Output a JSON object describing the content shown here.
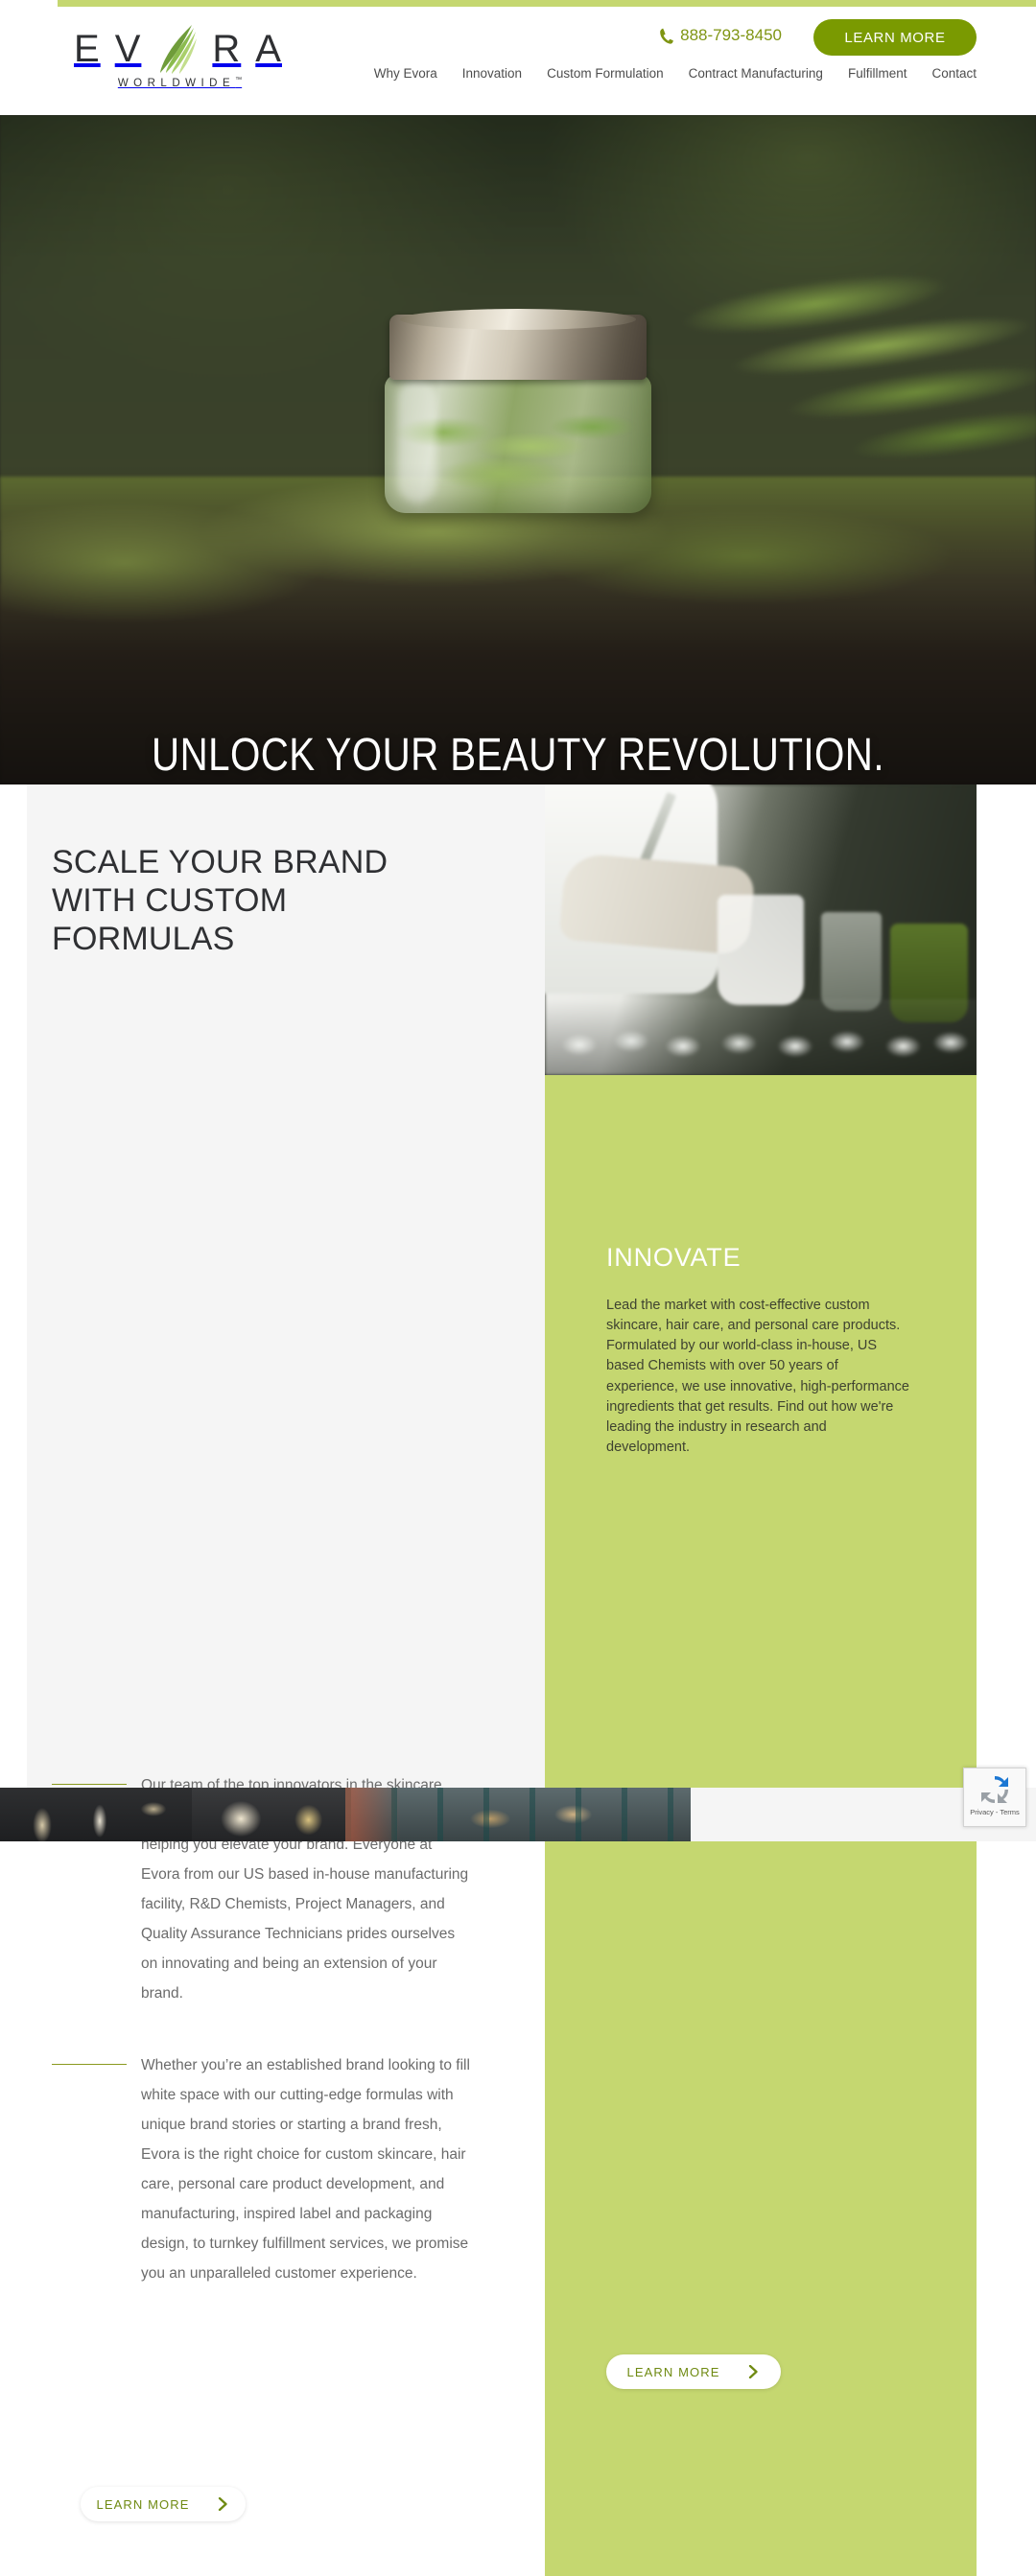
{
  "brand": {
    "name_letters": [
      "E",
      "V",
      "R",
      "A"
    ],
    "leaf_icon": "leaf-icon",
    "tagline": "WORLDWIDE",
    "trademark": "™",
    "accent_green": "#7a9a01",
    "panel_green": "#c5d770",
    "text_dark": "#2f3033"
  },
  "header": {
    "phone": "888-793-8450",
    "phone_icon": "phone-icon",
    "cta_label": "LEARN MORE",
    "nav": [
      {
        "label": "Why Evora"
      },
      {
        "label": "Innovation"
      },
      {
        "label": "Custom Formulation"
      },
      {
        "label": "Contract Manufacturing"
      },
      {
        "label": "Fulfillment"
      },
      {
        "label": "Contact"
      }
    ]
  },
  "hero": {
    "headline": "UNLOCK YOUR BEAUTY REVOLUTION.",
    "image_alt": "cosmetic-jar-on-moss"
  },
  "main": {
    "section_title": "SCALE YOUR BRAND WITH CUSTOM FORMULAS",
    "paragraphs": [
      "Our team of the top innovators in the skincare industry approaches every project with the goal of helping you elevate your brand. Everyone at Evora from our US based in-house manufacturing facility, R&D Chemists, Project Managers, and Quality Assurance Technicians prides ourselves on innovating and being an extension of your brand.",
      "Whether you’re an established brand looking to fill white space with our cutting-edge formulas with unique brand stories or starting a brand fresh, Evora is the right choice for custom skincare, hair care, personal care product development, and manufacturing, inspired label and packaging design, to turnkey fulfillment services, we promise you an unparalleled customer experience."
    ],
    "learn_more_label": "LEARN MORE",
    "arrow_icon": "chevron-right-icon"
  },
  "innovate_panel": {
    "image_alt": "chemist-pouring-powder-in-lab",
    "title": "INNOVATE",
    "body": "Lead the market with cost-effective custom skincare, hair care, and personal care products. Formulated by our world-class in-house, US based Chemists with over 50 years of experience, we use innovative, high-performance ingredients that get results. Find out how we're leading the industry in research and development.",
    "learn_more_label": "LEARN MORE",
    "arrow_icon": "chevron-right-icon"
  },
  "bottom_strip": {
    "tiles": [
      {
        "alt": "cosmetics-flatlay"
      },
      {
        "alt": "gold-packaging"
      },
      {
        "alt": "warehouse-shelving"
      }
    ]
  },
  "recaptcha": {
    "logo_icon": "recaptcha-icon",
    "legal": "Privacy - Terms"
  }
}
